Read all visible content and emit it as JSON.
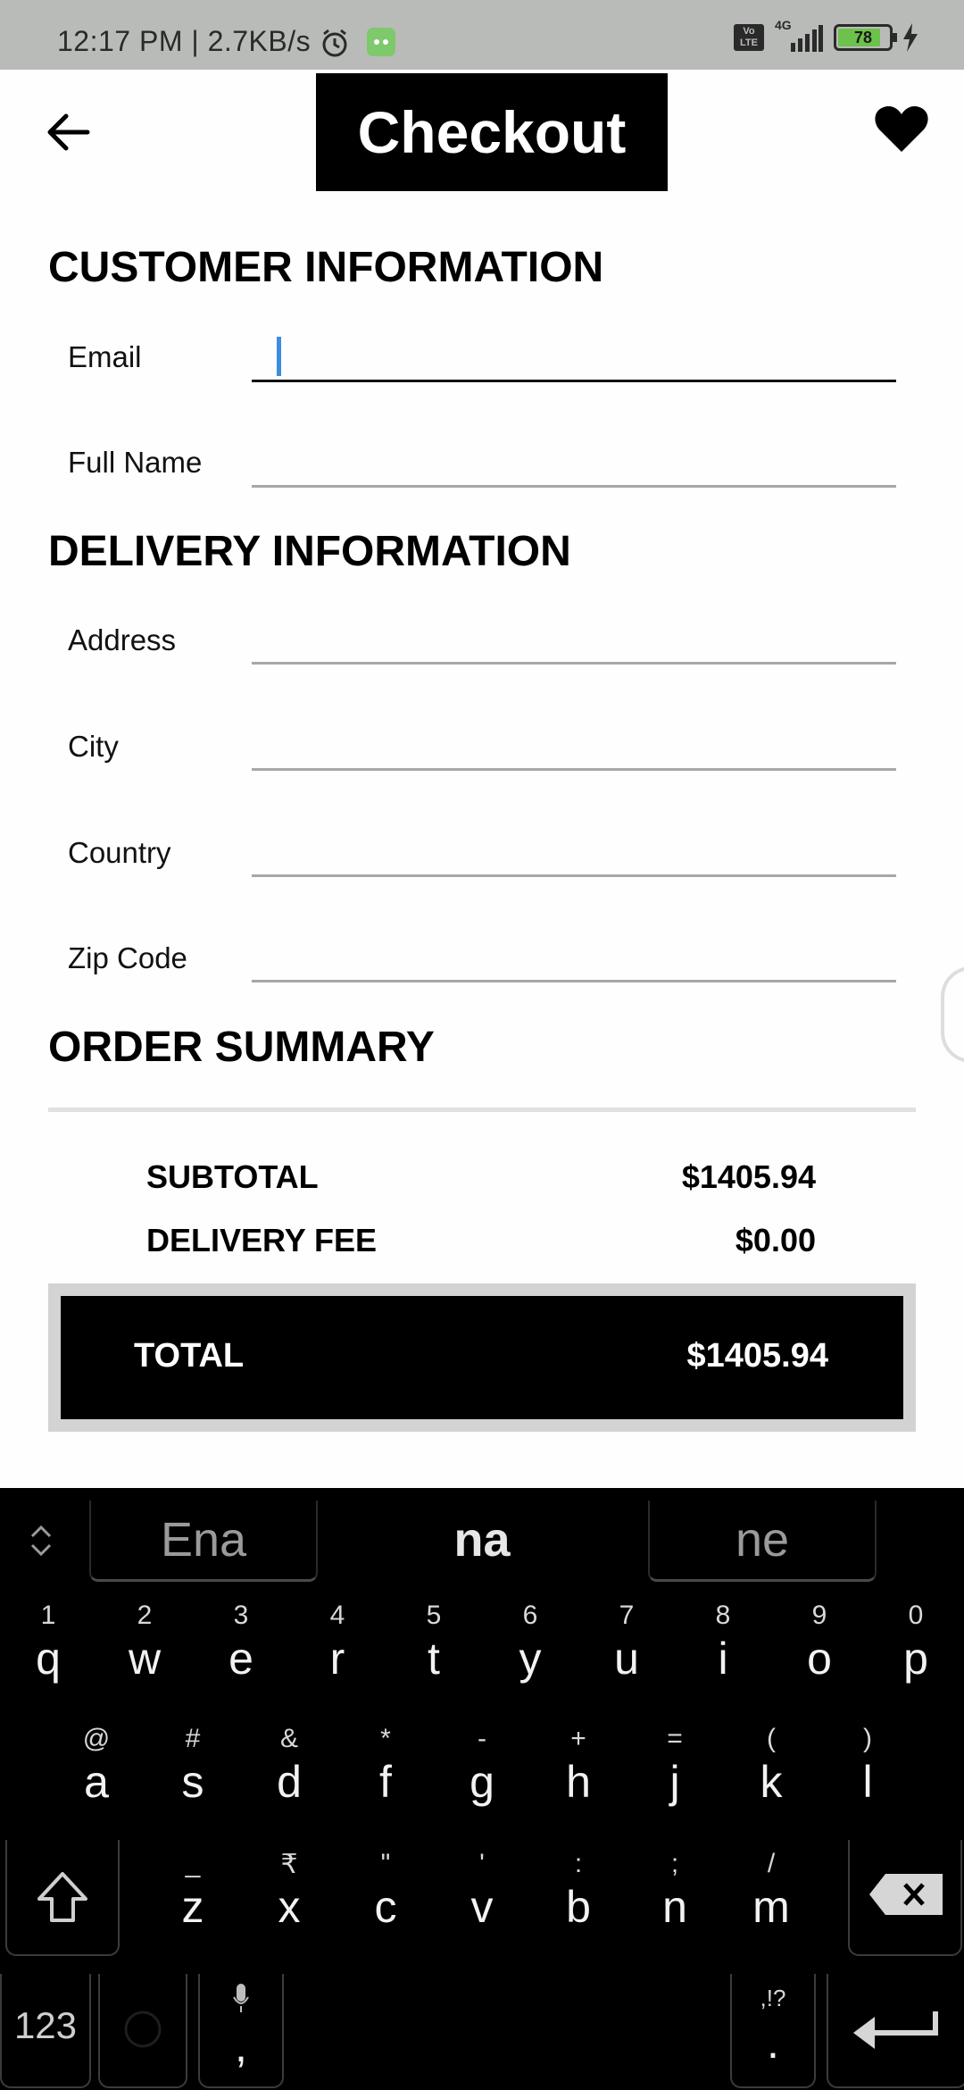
{
  "status_bar": {
    "time_speed": "12:17 PM | 2.7KB/s",
    "network": "4G",
    "volte": "Vo LTE",
    "battery": "78"
  },
  "header": {
    "title": "Checkout"
  },
  "sections": {
    "customer": "CUSTOMER INFORMATION",
    "delivery": "DELIVERY INFORMATION",
    "summary": "ORDER SUMMARY"
  },
  "fields": {
    "email": {
      "label": "Email",
      "value": ""
    },
    "full_name": {
      "label": "Full Name",
      "value": ""
    },
    "address": {
      "label": "Address",
      "value": ""
    },
    "city": {
      "label": "City",
      "value": ""
    },
    "country": {
      "label": "Country",
      "value": ""
    },
    "zip": {
      "label": "Zip Code",
      "value": ""
    }
  },
  "summary": {
    "subtotal_label": "SUBTOTAL",
    "subtotal_value": "$1405.94",
    "delivery_label": "DELIVERY FEE",
    "delivery_value": "$0.00",
    "total_label": "TOTAL",
    "total_value": "$1405.94"
  },
  "keyboard": {
    "suggestions": [
      "Ena",
      "na",
      "ne"
    ],
    "row1": [
      {
        "key": "q",
        "alt": "1"
      },
      {
        "key": "w",
        "alt": "2"
      },
      {
        "key": "e",
        "alt": "3"
      },
      {
        "key": "r",
        "alt": "4"
      },
      {
        "key": "t",
        "alt": "5"
      },
      {
        "key": "y",
        "alt": "6"
      },
      {
        "key": "u",
        "alt": "7"
      },
      {
        "key": "i",
        "alt": "8"
      },
      {
        "key": "o",
        "alt": "9"
      },
      {
        "key": "p",
        "alt": "0"
      }
    ],
    "row2": [
      {
        "key": "a",
        "alt": "@"
      },
      {
        "key": "s",
        "alt": "#"
      },
      {
        "key": "d",
        "alt": "&"
      },
      {
        "key": "f",
        "alt": "*"
      },
      {
        "key": "g",
        "alt": "-"
      },
      {
        "key": "h",
        "alt": "+"
      },
      {
        "key": "j",
        "alt": "="
      },
      {
        "key": "k",
        "alt": "("
      },
      {
        "key": "l",
        "alt": ")"
      }
    ],
    "row3": [
      {
        "key": "z",
        "alt": "_"
      },
      {
        "key": "x",
        "alt": "₹"
      },
      {
        "key": "c",
        "alt": "\""
      },
      {
        "key": "v",
        "alt": "'"
      },
      {
        "key": "b",
        "alt": ":"
      },
      {
        "key": "n",
        "alt": ";"
      },
      {
        "key": "m",
        "alt": "/"
      }
    ],
    "numbers_label": "123",
    "comma": ",",
    "period": ".",
    "period_alt": ",!?"
  }
}
